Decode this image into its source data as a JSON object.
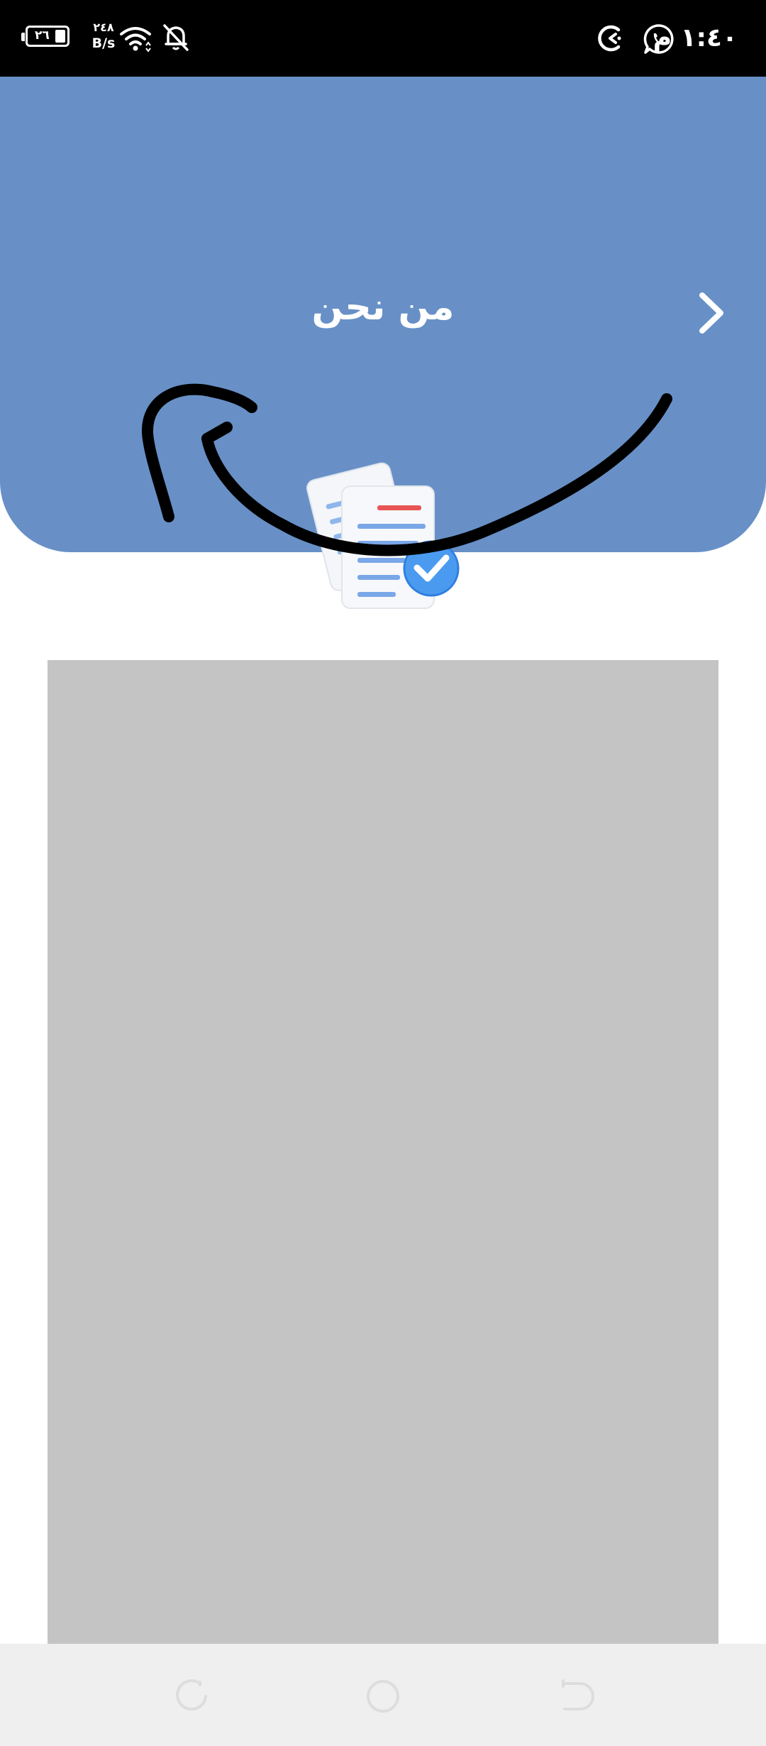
{
  "status_bar": {
    "battery_level": "٢٦",
    "net_speed_value": "٢٤٨",
    "net_speed_unit": "B/s",
    "time": "١:٤٠ م",
    "icons": [
      "battery-icon",
      "wifi-icon",
      "bell-off-icon",
      "whatsapp-icon",
      "app-indicator-icon"
    ]
  },
  "header": {
    "title": "من نحن",
    "background_color": "#6890c7",
    "back_icon": "chevron-right-icon"
  },
  "illustration": {
    "icon": "documents-check-icon"
  },
  "content": {
    "placeholder_color": "#c4c4c4"
  },
  "nav_bar": {
    "buttons": [
      "recent-apps-icon",
      "home-icon",
      "back-icon"
    ]
  }
}
